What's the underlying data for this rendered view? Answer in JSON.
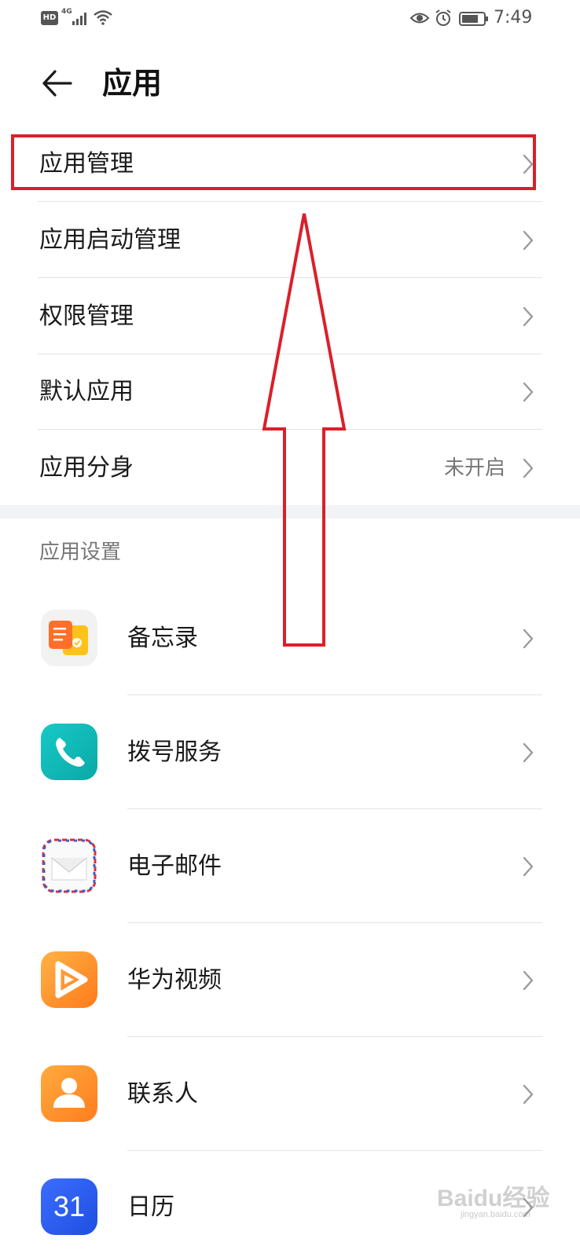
{
  "status_bar": {
    "hd": "HD",
    "network": "4G",
    "time": "7:49"
  },
  "header": {
    "title": "应用"
  },
  "menu": [
    {
      "label": "应用管理",
      "value": ""
    },
    {
      "label": "应用启动管理",
      "value": ""
    },
    {
      "label": "权限管理",
      "value": ""
    },
    {
      "label": "默认应用",
      "value": ""
    },
    {
      "label": "应用分身",
      "value": "未开启"
    }
  ],
  "section": {
    "title": "应用设置"
  },
  "apps": [
    {
      "label": "备忘录",
      "icon": "notes-icon"
    },
    {
      "label": "拨号服务",
      "icon": "phone-icon"
    },
    {
      "label": "电子邮件",
      "icon": "mail-icon"
    },
    {
      "label": "华为视频",
      "icon": "video-play-icon"
    },
    {
      "label": "联系人",
      "icon": "contact-icon"
    },
    {
      "label": "日历",
      "icon": "calendar-icon",
      "icon_text": "31"
    }
  ],
  "annotation": {
    "color": "#d9202a"
  },
  "watermark": {
    "text": "Baidu经验",
    "sub": "jingyan.baidu.com"
  }
}
